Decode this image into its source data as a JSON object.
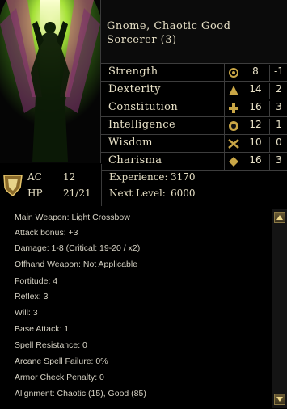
{
  "character": {
    "race_alignment": "Gnome, Chaotic Good",
    "class_level": "Sorcerer (3)"
  },
  "abilities": [
    {
      "name": "Strength",
      "score": "8",
      "mod": "-1",
      "icon": "strength-icon"
    },
    {
      "name": "Dexterity",
      "score": "14",
      "mod": "2",
      "icon": "dexterity-icon"
    },
    {
      "name": "Constitution",
      "score": "16",
      "mod": "3",
      "icon": "constitution-icon"
    },
    {
      "name": "Intelligence",
      "score": "12",
      "mod": "1",
      "icon": "intelligence-icon"
    },
    {
      "name": "Wisdom",
      "score": "10",
      "mod": "0",
      "icon": "wisdom-icon"
    },
    {
      "name": "Charisma",
      "score": "16",
      "mod": "3",
      "icon": "charisma-icon"
    }
  ],
  "combat": {
    "ac_label": "AC",
    "ac_value": "12",
    "hp_label": "HP",
    "hp_value": "21/21"
  },
  "progress": {
    "experience_label": "Experience:",
    "experience_value": "3170",
    "next_level_label": "Next Level:",
    "next_level_value": "6000"
  },
  "details": [
    {
      "label": "Main Weapon:",
      "value": "Light Crossbow"
    },
    {
      "label": "Attack bonus:",
      "value": "+3"
    },
    {
      "label": "Damage:",
      "value": "1-8 (Critical: 19-20 / x2)"
    },
    {
      "label": "Offhand Weapon:",
      "value": "Not Applicable"
    },
    {
      "label": "Fortitude:",
      "value": "4"
    },
    {
      "label": "Reflex:",
      "value": "3"
    },
    {
      "label": "Will:",
      "value": "3"
    },
    {
      "label": "Base Attack:",
      "value": "1"
    },
    {
      "label": "Spell Resistance:",
      "value": "0"
    },
    {
      "label": "Arcane Spell Failure:",
      "value": "0%"
    },
    {
      "label": "Armor Check Penalty:",
      "value": "0"
    },
    {
      "label": "Alignment:",
      "value": "Chaotic (15), Good (85)"
    }
  ],
  "colors": {
    "accent": "#c9a646",
    "text": "#e8e2cc",
    "border": "#3d3d3d"
  }
}
